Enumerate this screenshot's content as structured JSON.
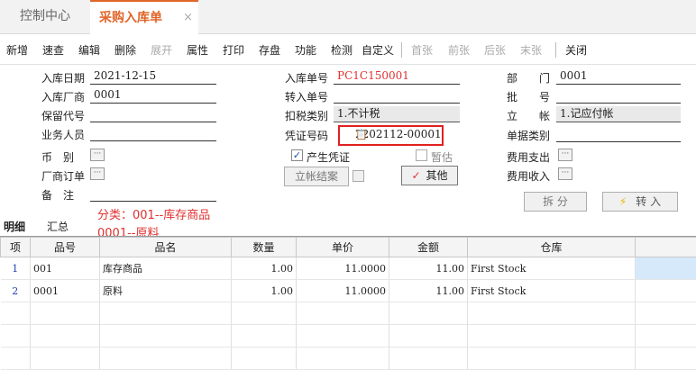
{
  "tabs": {
    "control_center": "控制中心",
    "purchase_receipt": "采购入库单",
    "close_icon": "×"
  },
  "toolbar": {
    "items": [
      "新增",
      "速查",
      "编辑",
      "删除",
      "展开",
      "属性",
      "打印",
      "存盘",
      "功能",
      "检测",
      "自定义"
    ],
    "nav": [
      "首张",
      "前张",
      "后张",
      "末张"
    ],
    "close": "关闭",
    "disabled": [
      "展开",
      "首张",
      "前张",
      "后张",
      "末张"
    ]
  },
  "header": {
    "in_date_label": "入库日期",
    "in_date_value": "2021-12-15",
    "vendor_label": "入库厂商",
    "vendor_value": "0001",
    "reserve_code_label": "保留代号",
    "reserve_code_value": "",
    "salesperson_label": "业务人员",
    "salesperson_value": "",
    "currency_label": "币　别",
    "vendor_order_label": "厂商订单",
    "remark_label": "备　注",
    "receipt_no_label": "入库单号",
    "receipt_no_value": "PC1C150001",
    "transfer_no_label": "转入单号",
    "transfer_no_value": "",
    "tax_type_label": "扣税类别",
    "tax_type_value": "1.不计税",
    "voucher_no_label": "凭证号码",
    "voucher_no_value": "2202112-00001",
    "gen_voucher_label": "产生凭证",
    "temp_label": "暂估",
    "setup_close_label": "立帐结案",
    "other_label": "其他",
    "dept_label": "部　　门",
    "dept_value": "0001",
    "batch_label": "批　　号",
    "batch_value": "",
    "account_label": "立　　帐",
    "account_value": "1.记应付帐",
    "doc_category_label": "单据类别",
    "doc_category_value": "",
    "expense_out_label": "费用支出",
    "expense_in_label": "费用收入",
    "split_label": "拆 分",
    "transfer_in_label": "转 入",
    "category_note_1": "分类：001--库存商品",
    "category_note_2": "0001--原料"
  },
  "detail_tabs": [
    "明细",
    "汇总"
  ],
  "grid": {
    "columns": [
      "项",
      "品号",
      "品名",
      "数量",
      "单价",
      "金额",
      "仓库"
    ],
    "rows": [
      {
        "idx": "1",
        "code": "001",
        "name": "库存商品",
        "qty": "1.00",
        "price": "11.0000",
        "amount": "11.00",
        "warehouse": "First Stock"
      },
      {
        "idx": "2",
        "code": "0001",
        "name": "原料",
        "qty": "1.00",
        "price": "11.0000",
        "amount": "11.00",
        "warehouse": "First Stock"
      }
    ]
  },
  "colors": {
    "accent": "#e0662a",
    "red": "#e03030",
    "link_blue": "#1a3fb0",
    "selection": "#d6e9fb"
  }
}
